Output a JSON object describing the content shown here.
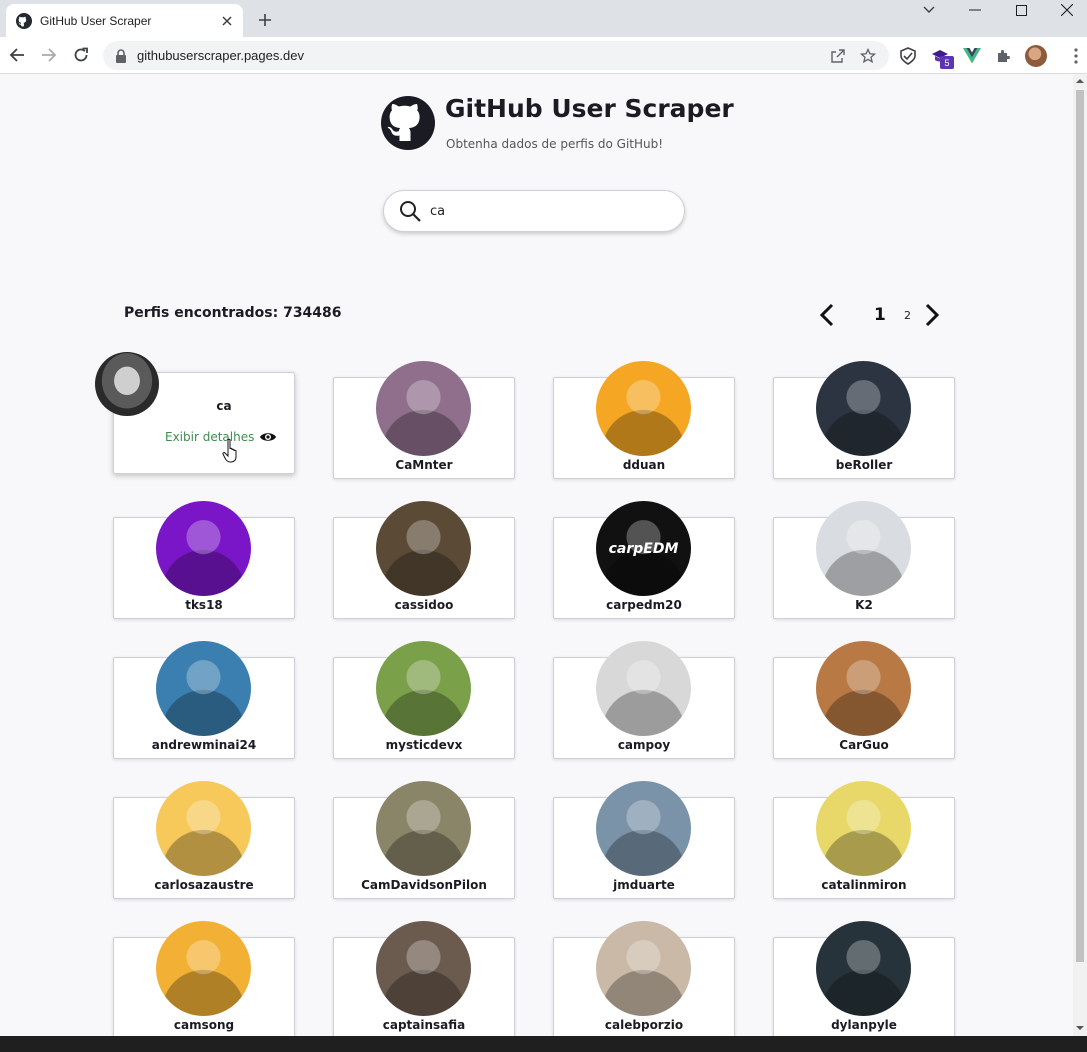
{
  "browser": {
    "tab_title": "GitHub User Scraper",
    "url": "githubuserscraper.pages.dev",
    "extension_badge": "5"
  },
  "header": {
    "title": "GitHub User Scraper",
    "subtitle": "Obtenha dados de perfis do GitHub!"
  },
  "search": {
    "value": "ca"
  },
  "results": {
    "count_label": "Perfis encontrados: 734486"
  },
  "pagination": {
    "current": "1",
    "next_page": "2"
  },
  "hover_card": {
    "login": "ca",
    "details_label": "Exibir detalhes"
  },
  "users": [
    {
      "login": "CaMnter",
      "color": "#8f6f8c"
    },
    {
      "login": "dduan",
      "color": "#f5a623"
    },
    {
      "login": "beRoller",
      "color": "#2b3440"
    },
    {
      "login": "tks18",
      "color": "#7a16c8"
    },
    {
      "login": "cassidoo",
      "color": "#5a4a36"
    },
    {
      "login": "carpedm20",
      "color": "#111111"
    },
    {
      "login": "K2",
      "color": "#d9dce0"
    },
    {
      "login": "andrewminai24",
      "color": "#3a7fb0"
    },
    {
      "login": "mysticdevx",
      "color": "#7aa04a"
    },
    {
      "login": "campoy",
      "color": "#d8d8d8"
    },
    {
      "login": "CarGuo",
      "color": "#b87944"
    },
    {
      "login": "carlosazaustre",
      "color": "#f7c85a"
    },
    {
      "login": "CamDavidsonPilon",
      "color": "#8a8468"
    },
    {
      "login": "jmduarte",
      "color": "#7a93a8"
    },
    {
      "login": "catalinmiron",
      "color": "#e8d86a"
    },
    {
      "login": "camsong",
      "color": "#f2b134"
    },
    {
      "login": "captainsafia",
      "color": "#6b5a4e"
    },
    {
      "login": "calebporzio",
      "color": "#c9b9a6"
    },
    {
      "login": "dylanpyle",
      "color": "#26333a"
    }
  ],
  "avatar_labels": {
    "carpedm20": "carpEDM"
  }
}
